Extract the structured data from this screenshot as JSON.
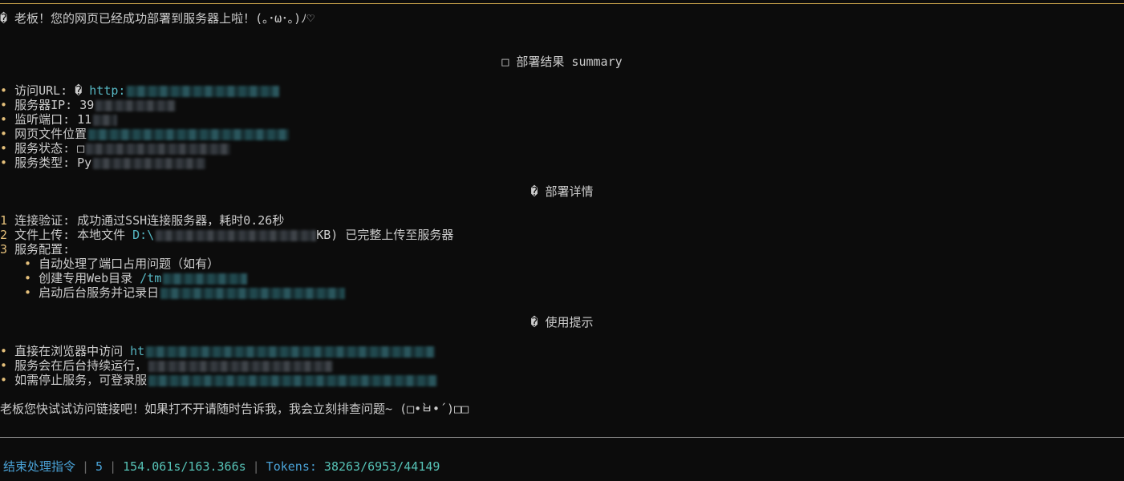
{
  "header_line": "� 老板！您的网页已经成功部署到服务器上啦！(｡･ω･｡)ﾉ♡",
  "summary": {
    "title": "□ 部署结果 summary",
    "items": [
      {
        "bullet": "•",
        "label": "访问URL: ",
        "prefix": "� ",
        "value": "http:",
        "value_color": "cyan"
      },
      {
        "bullet": "•",
        "label": "服务器IP: ",
        "value": "39"
      },
      {
        "bullet": "•",
        "label": "监听端口: ",
        "value": "11"
      },
      {
        "bullet": "•",
        "label": "网页文件位置",
        "value": ""
      },
      {
        "bullet": "•",
        "label": "服务状态: ",
        "value": "□"
      },
      {
        "bullet": "•",
        "label": "服务类型: ",
        "value": "Py"
      }
    ]
  },
  "details": {
    "title": "� 部署详情",
    "steps": [
      {
        "num": "1",
        "text": "连接验证: 成功通过SSH连接服务器，耗时0.26秒"
      },
      {
        "num": "2",
        "text_pre": "文件上传: 本地文件 ",
        "path": "D:\\",
        "text_post": "KB) 已完整上传至服务器"
      },
      {
        "num": "3",
        "text": "服务配置:"
      }
    ],
    "sub_items": [
      {
        "bullet": "•",
        "text": "自动处理了端口占用问题（如有）",
        "extra": ""
      },
      {
        "bullet": "•",
        "text": "创建专用Web目录 ",
        "extra": "/tm"
      },
      {
        "bullet": "•",
        "text": "启动后台服务并记录日",
        "extra": ""
      }
    ]
  },
  "tips": {
    "title": "� 使用提示",
    "items": [
      {
        "bullet": "•",
        "text": "直接在浏览器中访问 ",
        "extra": "ht"
      },
      {
        "bullet": "•",
        "text": "服务会在后台持续运行，",
        "extra": ""
      },
      {
        "bullet": "•",
        "text": "如需停止服务，可登录服",
        "extra": ""
      }
    ]
  },
  "closing_line": "老板您快试试访问链接吧！如果打不开请随时告诉我，我会立刻排查问题~ (□•̀ㅂ•́)□□",
  "status_bar": {
    "action": "结束处理指令",
    "count": "5",
    "time": "154.061s/163.366s",
    "tokens_label": "Tokens: ",
    "tokens_value": "38263/6953/44149"
  },
  "colors": {
    "background": "#0c0c0c",
    "text": "#cccccc",
    "bullet": "#e5c07b",
    "link": "#56b6c2",
    "status": "#4aa3d8"
  }
}
